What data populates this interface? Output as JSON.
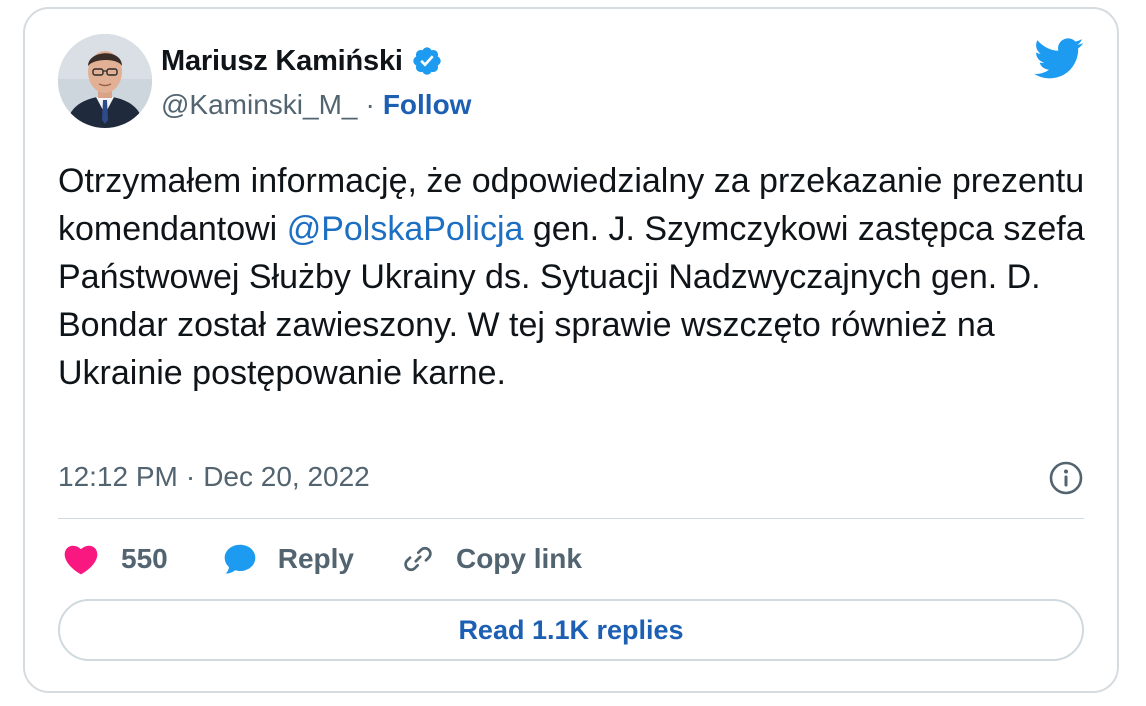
{
  "author": {
    "name": "Mariusz Kamiński",
    "handle": "@Kaminski_M_",
    "separator": "·",
    "follow_label": "Follow"
  },
  "tweet": {
    "text_before_mention": "Otrzymałem informację, że odpowiedzialny za przekazanie prezentu komendantowi ",
    "mention": "@PolskaPolicja",
    "text_after_mention": " gen. J. Szymczykowi zastępca szefa Państwowej Służby Ukrainy ds. Sytuacji Nadzwyczajnych gen. D. Bondar został zawieszony. W tej sprawie wszczęto również na Ukrainie postępowanie karne."
  },
  "meta": {
    "time": "12:12 PM",
    "separator": "·",
    "date": "Dec 20, 2022"
  },
  "actions": {
    "like_count": "550",
    "reply_label": "Reply",
    "copy_link_label": "Copy link"
  },
  "read_replies_label": "Read 1.1K replies",
  "icons": {
    "brand": "twitter-bird-icon",
    "verified": "verified-badge-icon",
    "info": "info-icon",
    "like": "heart-icon",
    "reply": "speech-bubble-icon",
    "copy": "link-icon"
  },
  "colors": {
    "text": "#0f1419",
    "secondary": "#536471",
    "link": "#1d6fc4",
    "twitter_blue": "#1d9bf0",
    "heart": "#f91880",
    "border": "#d6dbdf"
  }
}
